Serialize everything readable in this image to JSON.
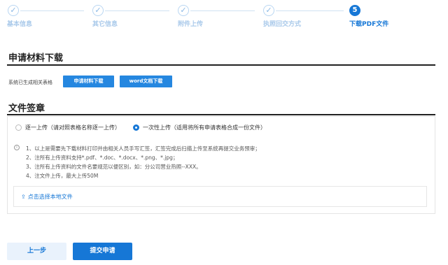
{
  "steps": [
    {
      "label": "基本信息",
      "state": "done",
      "icon": "check-icon"
    },
    {
      "label": "其它信息",
      "state": "done",
      "icon": "check-icon"
    },
    {
      "label": "附件上传",
      "state": "done",
      "icon": "check-icon"
    },
    {
      "label": "执照回交方式",
      "state": "done",
      "icon": "check-icon"
    },
    {
      "label": "下载PDF文件",
      "state": "active",
      "number": "5"
    }
  ],
  "download_section": {
    "title": "申请材料下载",
    "generated_label": "系统已生成相关表格",
    "download_button": "申请材料下载",
    "word_button": "word文档下载"
  },
  "sign_section": {
    "title": "文件签章",
    "options": [
      {
        "label": "逐一上传（请对照表格名称逐一上传）",
        "selected": false
      },
      {
        "label": "一次性上传（适用将所有申请表格合成一份文件）",
        "selected": true
      }
    ],
    "notes": [
      "1、以上是需要先下载材料打印并由相关人员手写汇签，汇签完成后扫描上传至系统再提交业务预审；",
      "2、注所有上传资料支持*.pdf、*.doc、*.docx、*.png、*.jpg；",
      "3、注所有上传资料的文件名要规范以便区别，如：分公司营业热照--XXX。",
      "4、注文件上传，最大上传50M"
    ],
    "upload_link": "点击选择本地文件"
  },
  "footer": {
    "prev_label": "上一步",
    "submit_label": "提交申请"
  },
  "colors": {
    "primary": "#1677d6",
    "step_done": "#a9c9ea"
  }
}
